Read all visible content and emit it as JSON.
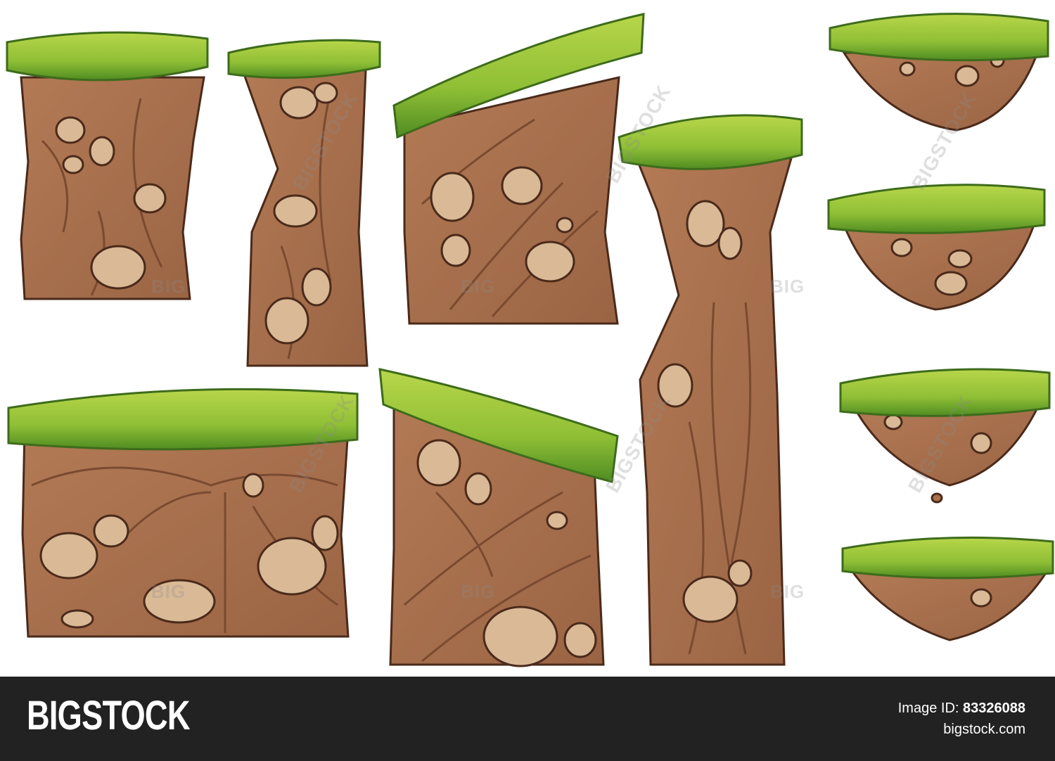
{
  "watermark": {
    "rotated_text": "BIGSTOCK",
    "short_text": "BIG"
  },
  "footer": {
    "brand": "BIGSTOCK",
    "image_id_label": "Image ID:",
    "image_id_value": "83326088",
    "site": "bigstock.com"
  },
  "colors": {
    "grass_light": "#a5c93a",
    "grass_dark": "#4f8c22",
    "dirt": "#a8714d",
    "dirt_dark": "#7a4a30",
    "rock": "#d9b996",
    "outline": "#4a2a1a",
    "footer_bg": "#222222"
  }
}
